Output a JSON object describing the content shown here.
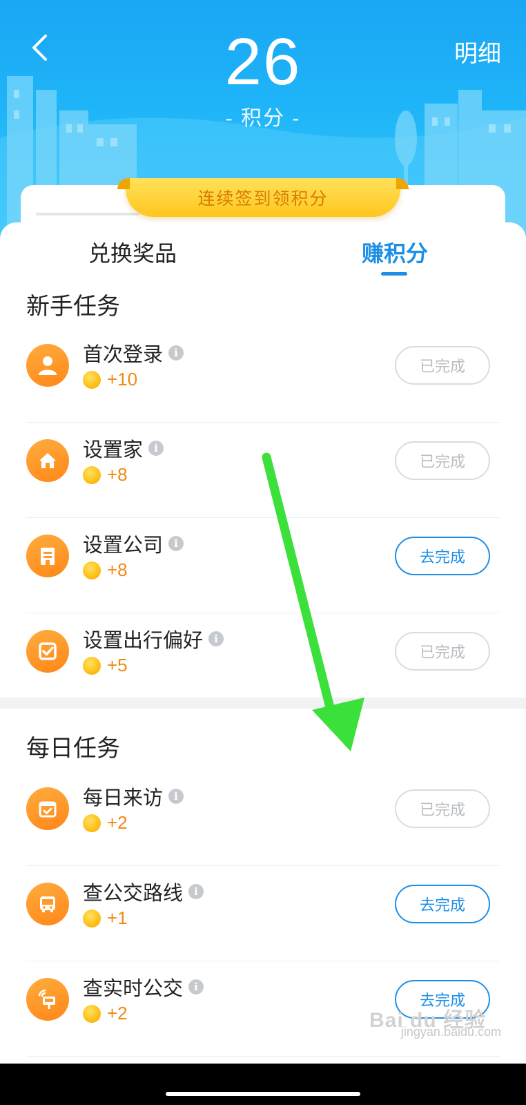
{
  "header": {
    "points_value": "26",
    "points_label": "- 积分 -",
    "detail_link": "明细",
    "checkin_banner": "连续签到领积分"
  },
  "tabs": [
    {
      "label": "兑换奖品",
      "active": false
    },
    {
      "label": "赚积分",
      "active": true
    }
  ],
  "sections": {
    "newbie": {
      "title": "新手任务",
      "tasks": [
        {
          "name": "首次登录",
          "reward": "+10",
          "status": "已完成",
          "icon": "user-icon"
        },
        {
          "name": "设置家",
          "reward": "+8",
          "status": "已完成",
          "icon": "home-icon"
        },
        {
          "name": "设置公司",
          "reward": "+8",
          "status": "去完成",
          "icon": "office-building-icon"
        },
        {
          "name": "设置出行偏好",
          "reward": "+5",
          "status": "已完成",
          "icon": "checkbox-icon"
        }
      ]
    },
    "daily": {
      "title": "每日任务",
      "tasks": [
        {
          "name": "每日来访",
          "reward": "+2",
          "status": "已完成",
          "icon": "calendar-check-icon"
        },
        {
          "name": "查公交路线",
          "reward": "+1",
          "status": "去完成",
          "icon": "bus-icon"
        },
        {
          "name": "查实时公交",
          "reward": "+2",
          "status": "去完成",
          "icon": "realtime-bus-stop-icon"
        }
      ]
    }
  },
  "watermark": {
    "logo": "Bai du 经验",
    "text": "jingyan.baidu.com"
  },
  "colors": {
    "header_blue": "#1aa6f4",
    "accent_blue": "#1d8fe6",
    "accent_orange": "#ff8718",
    "reward_orange": "#f08a12",
    "banner_yellow": "#ffc61e",
    "annotation_arrow_green": "#3be03b"
  }
}
